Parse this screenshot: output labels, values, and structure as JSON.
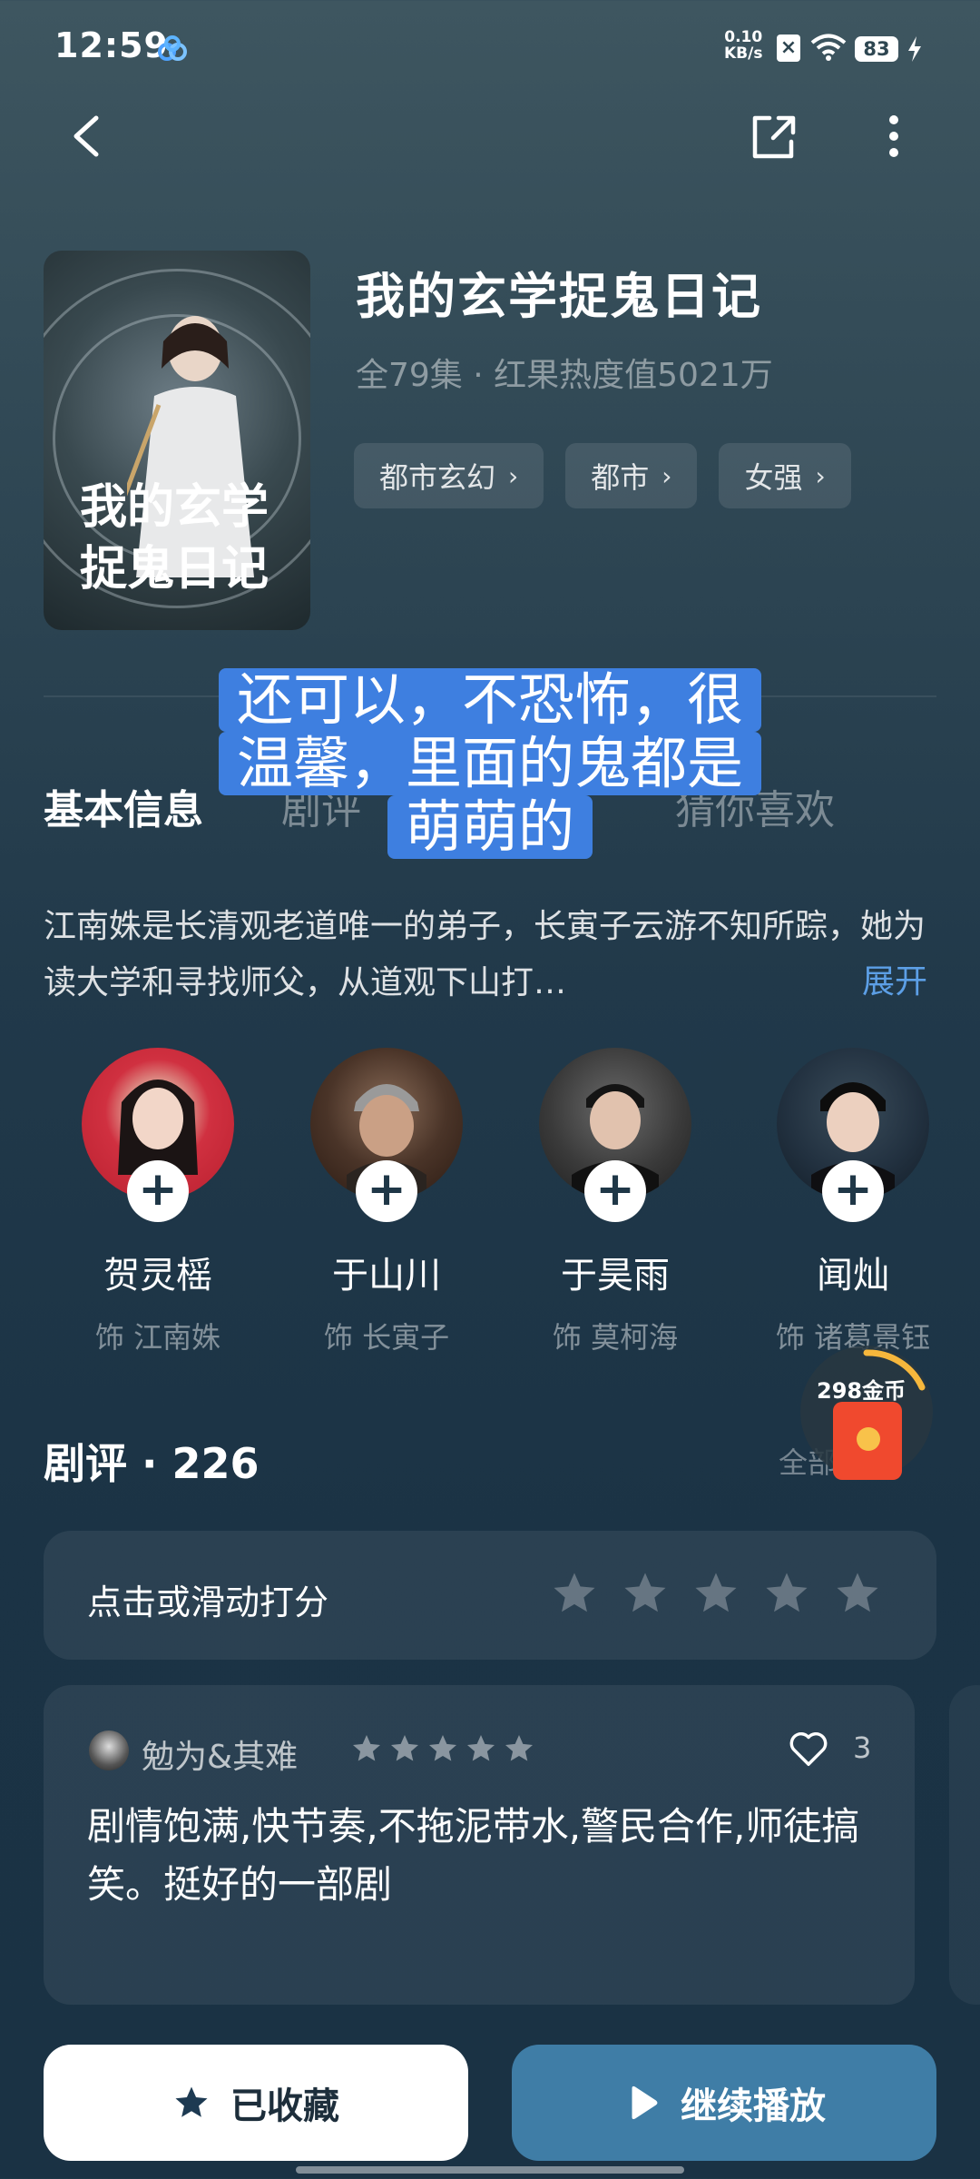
{
  "status_bar": {
    "time": "12:59",
    "net_speed_value": "0.10",
    "net_speed_unit": "KB/s",
    "battery": "83"
  },
  "show": {
    "title": "我的玄学捉鬼日记",
    "meta": "全79集 · 红果热度值5021万",
    "tags": [
      "都市玄幻",
      "都市",
      "女强"
    ],
    "poster_title_line1": "我的玄学",
    "poster_title_line2": "捉鬼日记"
  },
  "tabs": {
    "info": "基本信息",
    "review": "剧评",
    "recommend": "猜你喜欢"
  },
  "caption": {
    "line1": "还可以，不恐怖，很",
    "line2": "温馨，里面的鬼都是",
    "line3": "萌萌的"
  },
  "synopsis": {
    "text": "江南姝是长清观老道唯一的弟子，长寅子云游不知所踪，她为读大学和寻找师父，从道观下山打…",
    "expand": "展开"
  },
  "cast": [
    {
      "name": "贺灵榣",
      "role": "饰 江南姝"
    },
    {
      "name": "于山川",
      "role": "饰 长寅子"
    },
    {
      "name": "于昊雨",
      "role": "饰 莫柯海"
    },
    {
      "name": "闻灿",
      "role": "饰 诸葛景钰"
    }
  ],
  "reviews": {
    "header": "剧评 · 226",
    "all_label": "全部",
    "rating_prompt": "点击或滑动打分",
    "rating_stars_total": 5,
    "item": {
      "author": "勉为&其难",
      "stars": 5,
      "likes": "3",
      "text": "剧情饱满,快节奏,不拖泥带水,警民合作,师徒搞笑。挺好的一部剧"
    }
  },
  "reward": {
    "coins_label": "298金币"
  },
  "actions": {
    "collect": "已收藏",
    "play": "继续播放"
  }
}
